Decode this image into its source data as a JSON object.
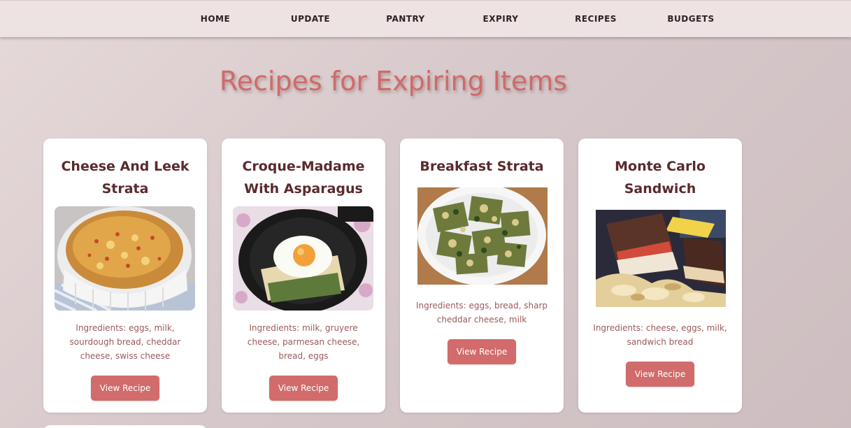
{
  "nav": {
    "items": [
      {
        "label": "HOME"
      },
      {
        "label": "UPDATE"
      },
      {
        "label": "PANTRY"
      },
      {
        "label": "EXPIRY"
      },
      {
        "label": "RECIPES"
      },
      {
        "label": "BUDGETS"
      }
    ]
  },
  "page": {
    "title": "Recipes for Expiring Items"
  },
  "recipes": [
    {
      "title": "Cheese And Leek Strata",
      "image": "casserole-strata-photo",
      "ingredients": "Ingredients: eggs, milk, sourdough bread, cheddar cheese, swiss cheese",
      "button_label": "View Recipe"
    },
    {
      "title": "Croque-Madame With Asparagus",
      "image": "fried-egg-skillet-photo",
      "ingredients": "Ingredients: milk, gruyere cheese, parmesan cheese, bread, eggs",
      "button_label": "View Recipe"
    },
    {
      "title": "Breakfast Strata",
      "image": "spinach-strata-plate-photo",
      "ingredients": "Ingredients: eggs, bread, sharp cheddar cheese, milk",
      "button_label": "View Recipe"
    },
    {
      "title": "Monte Carlo Sandwich",
      "image": "grilled-sandwich-chips-photo",
      "ingredients": "Ingredients: cheese, eggs, milk, sandwich bread",
      "button_label": "View Recipe"
    }
  ]
}
